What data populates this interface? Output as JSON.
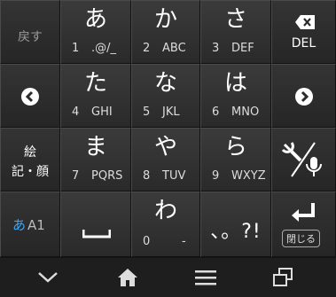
{
  "keys": {
    "back": "戻す",
    "a": {
      "kana": "あ",
      "num": "1",
      "sub": ".@/_"
    },
    "ka": {
      "kana": "か",
      "num": "2",
      "sub": "ABC"
    },
    "sa": {
      "kana": "さ",
      "num": "3",
      "sub": "DEF"
    },
    "del": "DEL",
    "ta": {
      "kana": "た",
      "num": "4",
      "sub": "GHI"
    },
    "na": {
      "kana": "な",
      "num": "5",
      "sub": "JKL"
    },
    "ha": {
      "kana": "は",
      "num": "6",
      "sub": "MNO"
    },
    "emoji_line1": "絵",
    "emoji_line2": "記・顔",
    "ma": {
      "kana": "ま",
      "num": "7",
      "sub": "PQRS"
    },
    "ya": {
      "kana": "や",
      "num": "8",
      "sub": "TUV"
    },
    "ra": {
      "kana": "ら",
      "num": "9",
      "sub": "WXYZ"
    },
    "mode_a": "あ",
    "mode_a1": "A1",
    "wa": {
      "kana": "わ",
      "num": "0",
      "sub": "-"
    },
    "punct": "、。?!",
    "close": "閉じる"
  },
  "colors": {
    "mode_accent": "#3fa9f5"
  },
  "icons": [
    "backspace-icon",
    "left-arrow-icon",
    "right-arrow-icon",
    "mic-icon",
    "space-icon",
    "enter-icon",
    "chevron-down-icon",
    "home-icon",
    "menu-icon",
    "recent-apps-icon"
  ]
}
